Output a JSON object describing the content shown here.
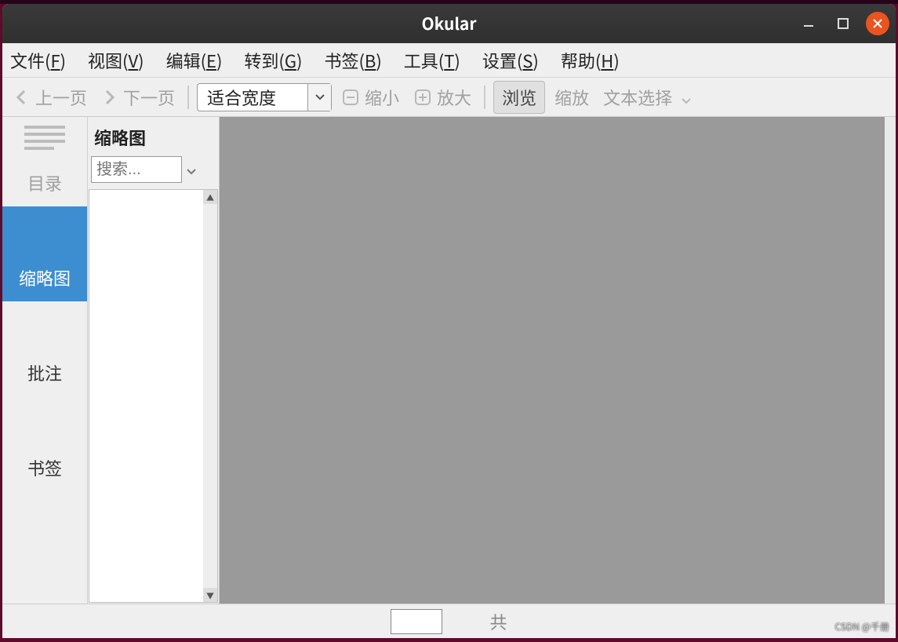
{
  "window": {
    "title": "Okular"
  },
  "menubar": {
    "items": [
      {
        "pre": "文件(",
        "key": "F",
        "post": ")"
      },
      {
        "pre": "视图(",
        "key": "V",
        "post": ")"
      },
      {
        "pre": "编辑(",
        "key": "E",
        "post": ")"
      },
      {
        "pre": "转到(",
        "key": "G",
        "post": ")"
      },
      {
        "pre": "书签(",
        "key": "B",
        "post": ")"
      },
      {
        "pre": "工具(",
        "key": "T",
        "post": ")"
      },
      {
        "pre": "设置(",
        "key": "S",
        "post": ")"
      },
      {
        "pre": "帮助(",
        "key": "H",
        "post": ")"
      }
    ]
  },
  "toolbar": {
    "prev": "上一页",
    "next": "下一页",
    "zoom_select": "适合宽度",
    "zoom_out": "缩小",
    "zoom_in": "放大",
    "browse": "浏览",
    "zoom": "缩放",
    "text_select": "文本选择"
  },
  "sidebar": {
    "tabs": {
      "contents": "目录",
      "thumbnails": "缩略图",
      "annotations": "批注",
      "bookmarks": "书签"
    },
    "panel_title": "缩略图",
    "search_placeholder": "搜索..."
  },
  "statusbar": {
    "page_value": "",
    "total_label": "共"
  },
  "watermark": "CSDN @千册"
}
